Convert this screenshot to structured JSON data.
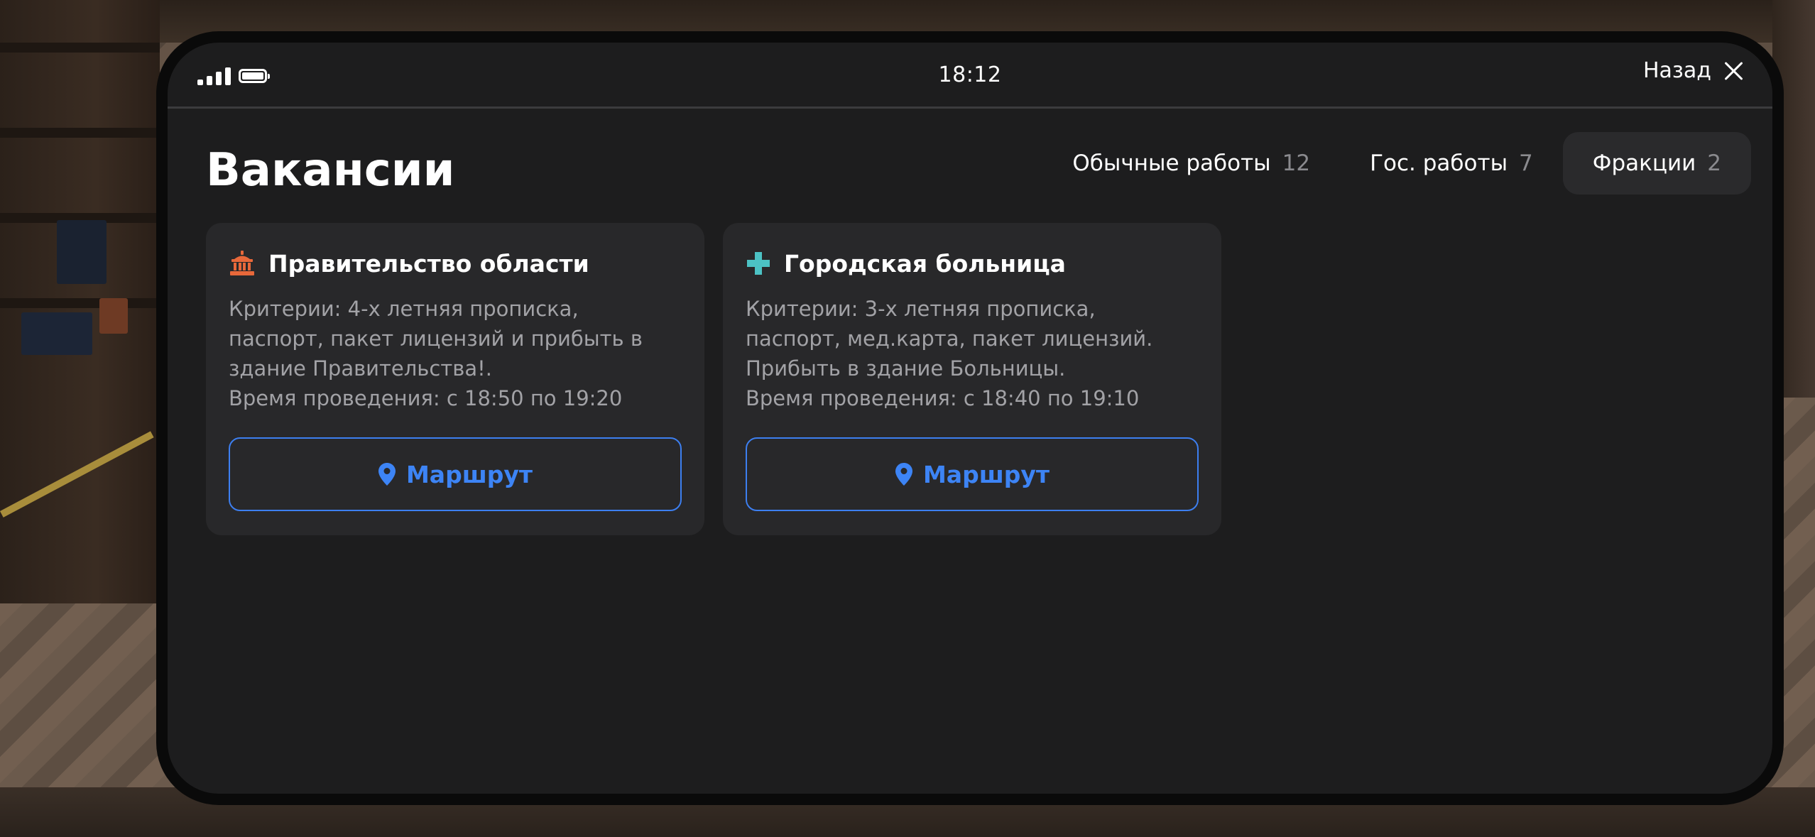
{
  "status": {
    "time": "18:12",
    "back_label": "Назад"
  },
  "page": {
    "title": "Вакансии"
  },
  "tabs": [
    {
      "label": "Обычные работы",
      "count": "12",
      "active": false
    },
    {
      "label": "Гос. работы",
      "count": "7",
      "active": false
    },
    {
      "label": "Фракции",
      "count": "2",
      "active": true
    }
  ],
  "cards": [
    {
      "icon": "government-building-icon",
      "title": "Правительство области",
      "text": "Критерии: 4-х летняя прописка,\nпаспорт, пакет лицензий и прибыть в\nздание Правительства!.\nВремя проведения: с 18:50 по 19:20",
      "button_label": "Маршрут"
    },
    {
      "icon": "medical-cross-icon",
      "title": "Городская больница",
      "text": "Критерии: 3-х летняя прописка,\nпаспорт, мед.карта, пакет лицензий.\nПрибыть в здание Больницы.\nВремя проведения: с 18:40 по 19:10",
      "button_label": "Маршрут"
    }
  ],
  "colors": {
    "accent": "#3d84f5",
    "gov_icon": "#e8683a",
    "med_icon": "#4cc2c4",
    "background": "#1d1d1e",
    "card": "#28282a"
  }
}
